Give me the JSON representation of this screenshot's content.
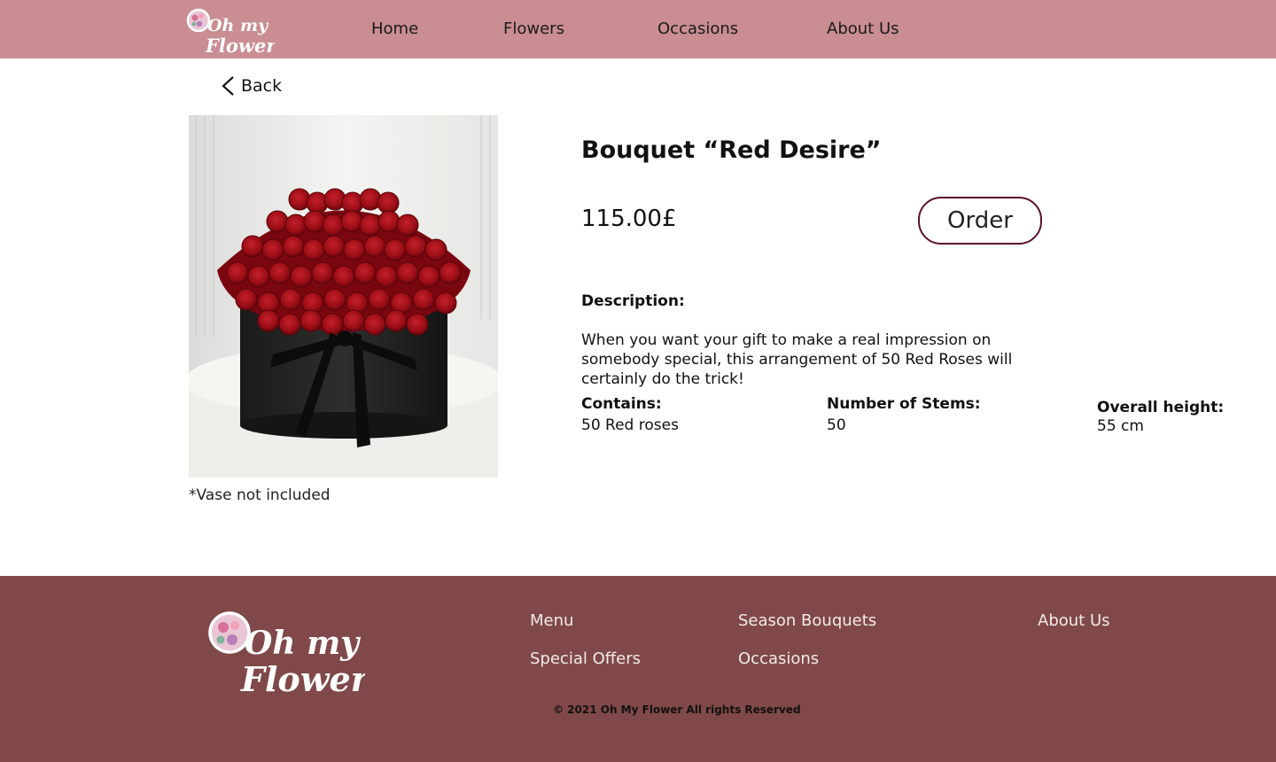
{
  "brand": {
    "logo_line1": "Oh my",
    "logo_line2": "Flower"
  },
  "nav": {
    "home": "Home",
    "flowers": "Flowers",
    "occasions": "Occasions",
    "about": "About Us"
  },
  "back_label": "Back",
  "product": {
    "title": "Bouquet “Red Desire”",
    "price": "115.00£",
    "order_label": "Order",
    "vase_note": "*Vase not included",
    "description_heading": "Description:",
    "description": "When you want your gift to make a real impression on somebody special, this arrangement of 50 Red Roses will certainly do the trick!",
    "specs": {
      "contains_label": "Contains:",
      "contains_value": "50 Red roses",
      "stems_label": "Number of Stems:",
      "stems_value": "50",
      "height_label": "Overall height:",
      "height_value": "55 cm"
    }
  },
  "footer": {
    "menu": "Menu",
    "special_offers": "Special Offers",
    "season_bouquets": "Season Bouquets",
    "occasions": "Occasions",
    "about": "About Us",
    "copyright": "© 2021  Oh My Flower All rights Reserved"
  },
  "colors": {
    "header_bg": "#c98d92",
    "footer_bg": "#804848",
    "order_border": "#5a1228"
  },
  "icons": [
    "chevron-left-icon"
  ]
}
